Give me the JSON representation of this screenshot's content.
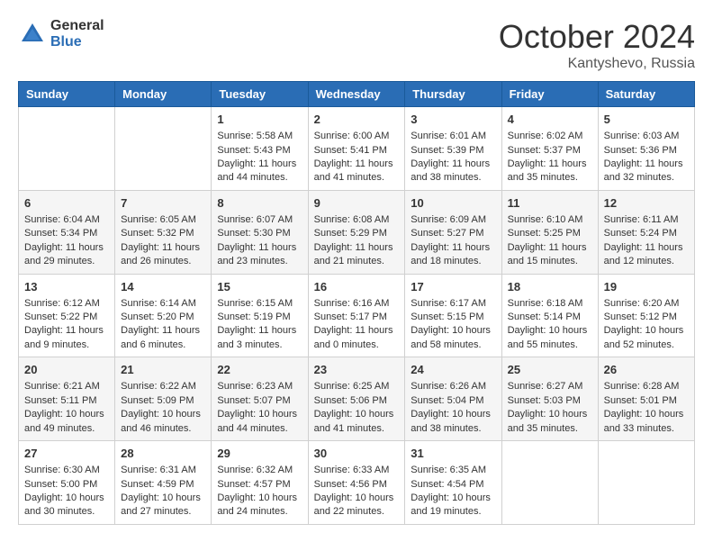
{
  "logo": {
    "general": "General",
    "blue": "Blue"
  },
  "title": "October 2024",
  "location": "Kantyshevo, Russia",
  "days_header": [
    "Sunday",
    "Monday",
    "Tuesday",
    "Wednesday",
    "Thursday",
    "Friday",
    "Saturday"
  ],
  "weeks": [
    [
      {
        "day": "",
        "sunrise": "",
        "sunset": "",
        "daylight": ""
      },
      {
        "day": "",
        "sunrise": "",
        "sunset": "",
        "daylight": ""
      },
      {
        "day": "1",
        "sunrise": "Sunrise: 5:58 AM",
        "sunset": "Sunset: 5:43 PM",
        "daylight": "Daylight: 11 hours and 44 minutes."
      },
      {
        "day": "2",
        "sunrise": "Sunrise: 6:00 AM",
        "sunset": "Sunset: 5:41 PM",
        "daylight": "Daylight: 11 hours and 41 minutes."
      },
      {
        "day": "3",
        "sunrise": "Sunrise: 6:01 AM",
        "sunset": "Sunset: 5:39 PM",
        "daylight": "Daylight: 11 hours and 38 minutes."
      },
      {
        "day": "4",
        "sunrise": "Sunrise: 6:02 AM",
        "sunset": "Sunset: 5:37 PM",
        "daylight": "Daylight: 11 hours and 35 minutes."
      },
      {
        "day": "5",
        "sunrise": "Sunrise: 6:03 AM",
        "sunset": "Sunset: 5:36 PM",
        "daylight": "Daylight: 11 hours and 32 minutes."
      }
    ],
    [
      {
        "day": "6",
        "sunrise": "Sunrise: 6:04 AM",
        "sunset": "Sunset: 5:34 PM",
        "daylight": "Daylight: 11 hours and 29 minutes."
      },
      {
        "day": "7",
        "sunrise": "Sunrise: 6:05 AM",
        "sunset": "Sunset: 5:32 PM",
        "daylight": "Daylight: 11 hours and 26 minutes."
      },
      {
        "day": "8",
        "sunrise": "Sunrise: 6:07 AM",
        "sunset": "Sunset: 5:30 PM",
        "daylight": "Daylight: 11 hours and 23 minutes."
      },
      {
        "day": "9",
        "sunrise": "Sunrise: 6:08 AM",
        "sunset": "Sunset: 5:29 PM",
        "daylight": "Daylight: 11 hours and 21 minutes."
      },
      {
        "day": "10",
        "sunrise": "Sunrise: 6:09 AM",
        "sunset": "Sunset: 5:27 PM",
        "daylight": "Daylight: 11 hours and 18 minutes."
      },
      {
        "day": "11",
        "sunrise": "Sunrise: 6:10 AM",
        "sunset": "Sunset: 5:25 PM",
        "daylight": "Daylight: 11 hours and 15 minutes."
      },
      {
        "day": "12",
        "sunrise": "Sunrise: 6:11 AM",
        "sunset": "Sunset: 5:24 PM",
        "daylight": "Daylight: 11 hours and 12 minutes."
      }
    ],
    [
      {
        "day": "13",
        "sunrise": "Sunrise: 6:12 AM",
        "sunset": "Sunset: 5:22 PM",
        "daylight": "Daylight: 11 hours and 9 minutes."
      },
      {
        "day": "14",
        "sunrise": "Sunrise: 6:14 AM",
        "sunset": "Sunset: 5:20 PM",
        "daylight": "Daylight: 11 hours and 6 minutes."
      },
      {
        "day": "15",
        "sunrise": "Sunrise: 6:15 AM",
        "sunset": "Sunset: 5:19 PM",
        "daylight": "Daylight: 11 hours and 3 minutes."
      },
      {
        "day": "16",
        "sunrise": "Sunrise: 6:16 AM",
        "sunset": "Sunset: 5:17 PM",
        "daylight": "Daylight: 11 hours and 0 minutes."
      },
      {
        "day": "17",
        "sunrise": "Sunrise: 6:17 AM",
        "sunset": "Sunset: 5:15 PM",
        "daylight": "Daylight: 10 hours and 58 minutes."
      },
      {
        "day": "18",
        "sunrise": "Sunrise: 6:18 AM",
        "sunset": "Sunset: 5:14 PM",
        "daylight": "Daylight: 10 hours and 55 minutes."
      },
      {
        "day": "19",
        "sunrise": "Sunrise: 6:20 AM",
        "sunset": "Sunset: 5:12 PM",
        "daylight": "Daylight: 10 hours and 52 minutes."
      }
    ],
    [
      {
        "day": "20",
        "sunrise": "Sunrise: 6:21 AM",
        "sunset": "Sunset: 5:11 PM",
        "daylight": "Daylight: 10 hours and 49 minutes."
      },
      {
        "day": "21",
        "sunrise": "Sunrise: 6:22 AM",
        "sunset": "Sunset: 5:09 PM",
        "daylight": "Daylight: 10 hours and 46 minutes."
      },
      {
        "day": "22",
        "sunrise": "Sunrise: 6:23 AM",
        "sunset": "Sunset: 5:07 PM",
        "daylight": "Daylight: 10 hours and 44 minutes."
      },
      {
        "day": "23",
        "sunrise": "Sunrise: 6:25 AM",
        "sunset": "Sunset: 5:06 PM",
        "daylight": "Daylight: 10 hours and 41 minutes."
      },
      {
        "day": "24",
        "sunrise": "Sunrise: 6:26 AM",
        "sunset": "Sunset: 5:04 PM",
        "daylight": "Daylight: 10 hours and 38 minutes."
      },
      {
        "day": "25",
        "sunrise": "Sunrise: 6:27 AM",
        "sunset": "Sunset: 5:03 PM",
        "daylight": "Daylight: 10 hours and 35 minutes."
      },
      {
        "day": "26",
        "sunrise": "Sunrise: 6:28 AM",
        "sunset": "Sunset: 5:01 PM",
        "daylight": "Daylight: 10 hours and 33 minutes."
      }
    ],
    [
      {
        "day": "27",
        "sunrise": "Sunrise: 6:30 AM",
        "sunset": "Sunset: 5:00 PM",
        "daylight": "Daylight: 10 hours and 30 minutes."
      },
      {
        "day": "28",
        "sunrise": "Sunrise: 6:31 AM",
        "sunset": "Sunset: 4:59 PM",
        "daylight": "Daylight: 10 hours and 27 minutes."
      },
      {
        "day": "29",
        "sunrise": "Sunrise: 6:32 AM",
        "sunset": "Sunset: 4:57 PM",
        "daylight": "Daylight: 10 hours and 24 minutes."
      },
      {
        "day": "30",
        "sunrise": "Sunrise: 6:33 AM",
        "sunset": "Sunset: 4:56 PM",
        "daylight": "Daylight: 10 hours and 22 minutes."
      },
      {
        "day": "31",
        "sunrise": "Sunrise: 6:35 AM",
        "sunset": "Sunset: 4:54 PM",
        "daylight": "Daylight: 10 hours and 19 minutes."
      },
      {
        "day": "",
        "sunrise": "",
        "sunset": "",
        "daylight": ""
      },
      {
        "day": "",
        "sunrise": "",
        "sunset": "",
        "daylight": ""
      }
    ]
  ]
}
